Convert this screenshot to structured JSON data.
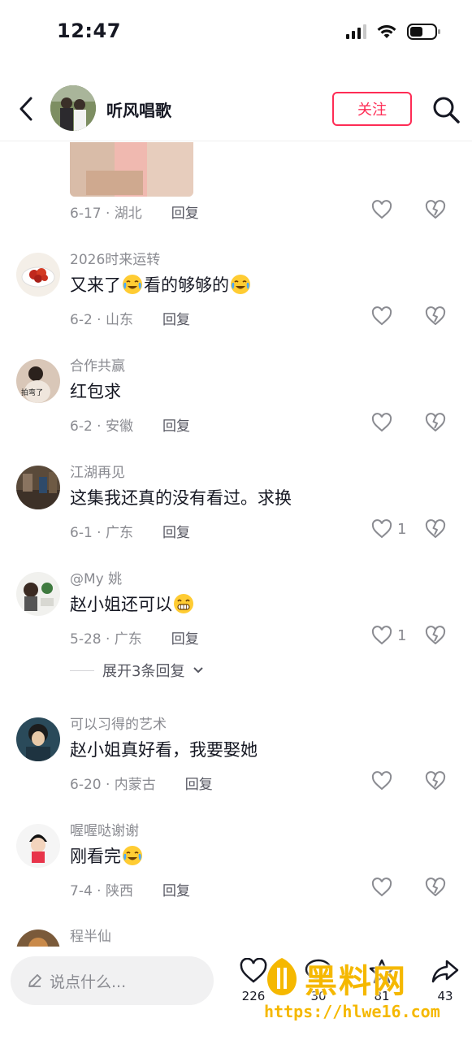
{
  "status_bar": {
    "time": "12:47"
  },
  "header": {
    "name": "听风唱歌",
    "follow_label": "关注"
  },
  "top_comment_tail": {
    "meta": "6-17 · 湖北",
    "reply": "回复"
  },
  "comments": [
    {
      "user": "2026时来运转",
      "text_a": "又来了",
      "text_b": "看的够够的",
      "meta": "6-2 · 山东",
      "reply": "回复",
      "likes": ""
    },
    {
      "user": "合作共赢",
      "text_a": "红包求",
      "meta": "6-2 · 安徽",
      "reply": "回复",
      "likes": ""
    },
    {
      "user": "江湖再见",
      "text_a": "这集我还真的没有看过。求换",
      "meta": "6-1 · 广东",
      "reply": "回复",
      "likes": "1"
    },
    {
      "user": "@My 姚",
      "text_a": "赵小姐还可以",
      "meta": "5-28 · 广东",
      "reply": "回复",
      "likes": "1",
      "expand": "展开3条回复"
    },
    {
      "user": "可以习得的艺术",
      "text_a": "赵小姐真好看，我要娶她",
      "meta": "6-20 · 内蒙古",
      "reply": "回复",
      "likes": ""
    },
    {
      "user": "喔喔哒谢谢",
      "text_a": "刚看完",
      "meta": "7-4 · 陕西",
      "reply": "回复",
      "likes": ""
    },
    {
      "user": "程半仙"
    }
  ],
  "bottom_bar": {
    "input_placeholder": "说点什么...",
    "like_count": "226",
    "comment_count": "30",
    "collect_count": "81",
    "share_count": "43"
  },
  "watermark": {
    "title": "黑料网",
    "url": "https://hlwe16.com"
  },
  "colors": {
    "accent": "#fe2c55",
    "muted": "#8a8b91",
    "text": "#161823",
    "watermark": "#f5b800"
  }
}
